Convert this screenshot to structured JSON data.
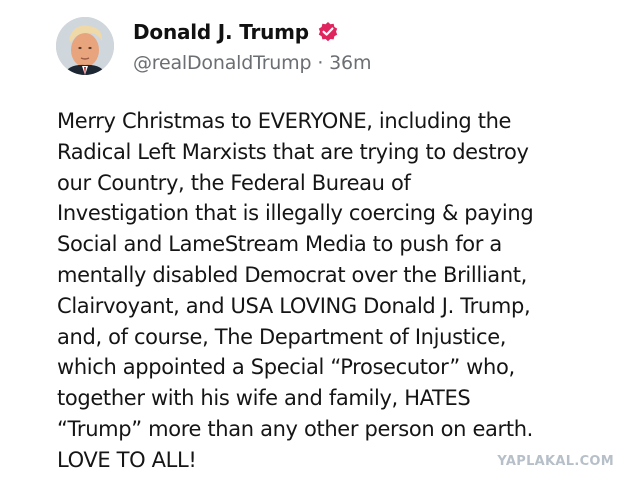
{
  "post": {
    "author": {
      "display_name": "Donald J. Trump",
      "handle": "@realDonaldTrump",
      "verified": true,
      "verified_color": "#e0245e",
      "avatar_icon": "profile-photo"
    },
    "separator": "·",
    "time_ago": "36m",
    "text": "Merry Christmas to EVERYONE, including the\nRadical Left Marxists that are trying to destroy\nour Country, the Federal Bureau of\nInvestigation that is illegally coercing & paying\nSocial and LameStream Media to push for a\nmentally disabled Democrat over the Brilliant,\nClairvoyant, and USA LOVING Donald J. Trump,\nand, of course, The Department of Injustice,\nwhich appointed a Special “Prosecutor” who,\ntogether with his wife and family, HATES\n“Trump” more than any other person on earth.\nLOVE TO ALL!"
  },
  "watermark": "YAPLAKAL.COM"
}
